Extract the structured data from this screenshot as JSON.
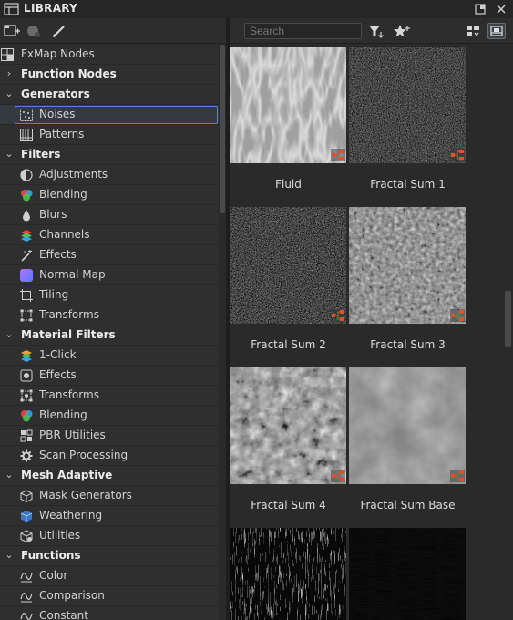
{
  "window": {
    "title": "LIBRARY"
  },
  "search": {
    "placeholder": "Search"
  },
  "tree": {
    "fxmap": "FxMap Nodes",
    "function_nodes": "Function Nodes",
    "generators": {
      "label": "Generators",
      "items": [
        "Noises",
        "Patterns"
      ]
    },
    "filters": {
      "label": "Filters",
      "items": [
        "Adjustments",
        "Blending",
        "Blurs",
        "Channels",
        "Effects",
        "Normal Map",
        "Tiling",
        "Transforms"
      ]
    },
    "material_filters": {
      "label": "Material Filters",
      "items": [
        "1-Click",
        "Effects",
        "Transforms",
        "Blending",
        "PBR Utilities",
        "Scan Processing"
      ]
    },
    "mesh_adaptive": {
      "label": "Mesh Adaptive",
      "items": [
        "Mask Generators",
        "Weathering",
        "Utilities"
      ]
    },
    "functions": {
      "label": "Functions",
      "items": [
        "Color",
        "Comparison",
        "Constant"
      ]
    },
    "selected": "Noises"
  },
  "grid": {
    "items": [
      "Fluid",
      "Fractal Sum 1",
      "Fractal Sum 2",
      "Fractal Sum 3",
      "Fractal Sum 4",
      "Fractal Sum Base"
    ]
  },
  "colors": {
    "accent": "#4f86c6",
    "badge": "#e0502a"
  }
}
